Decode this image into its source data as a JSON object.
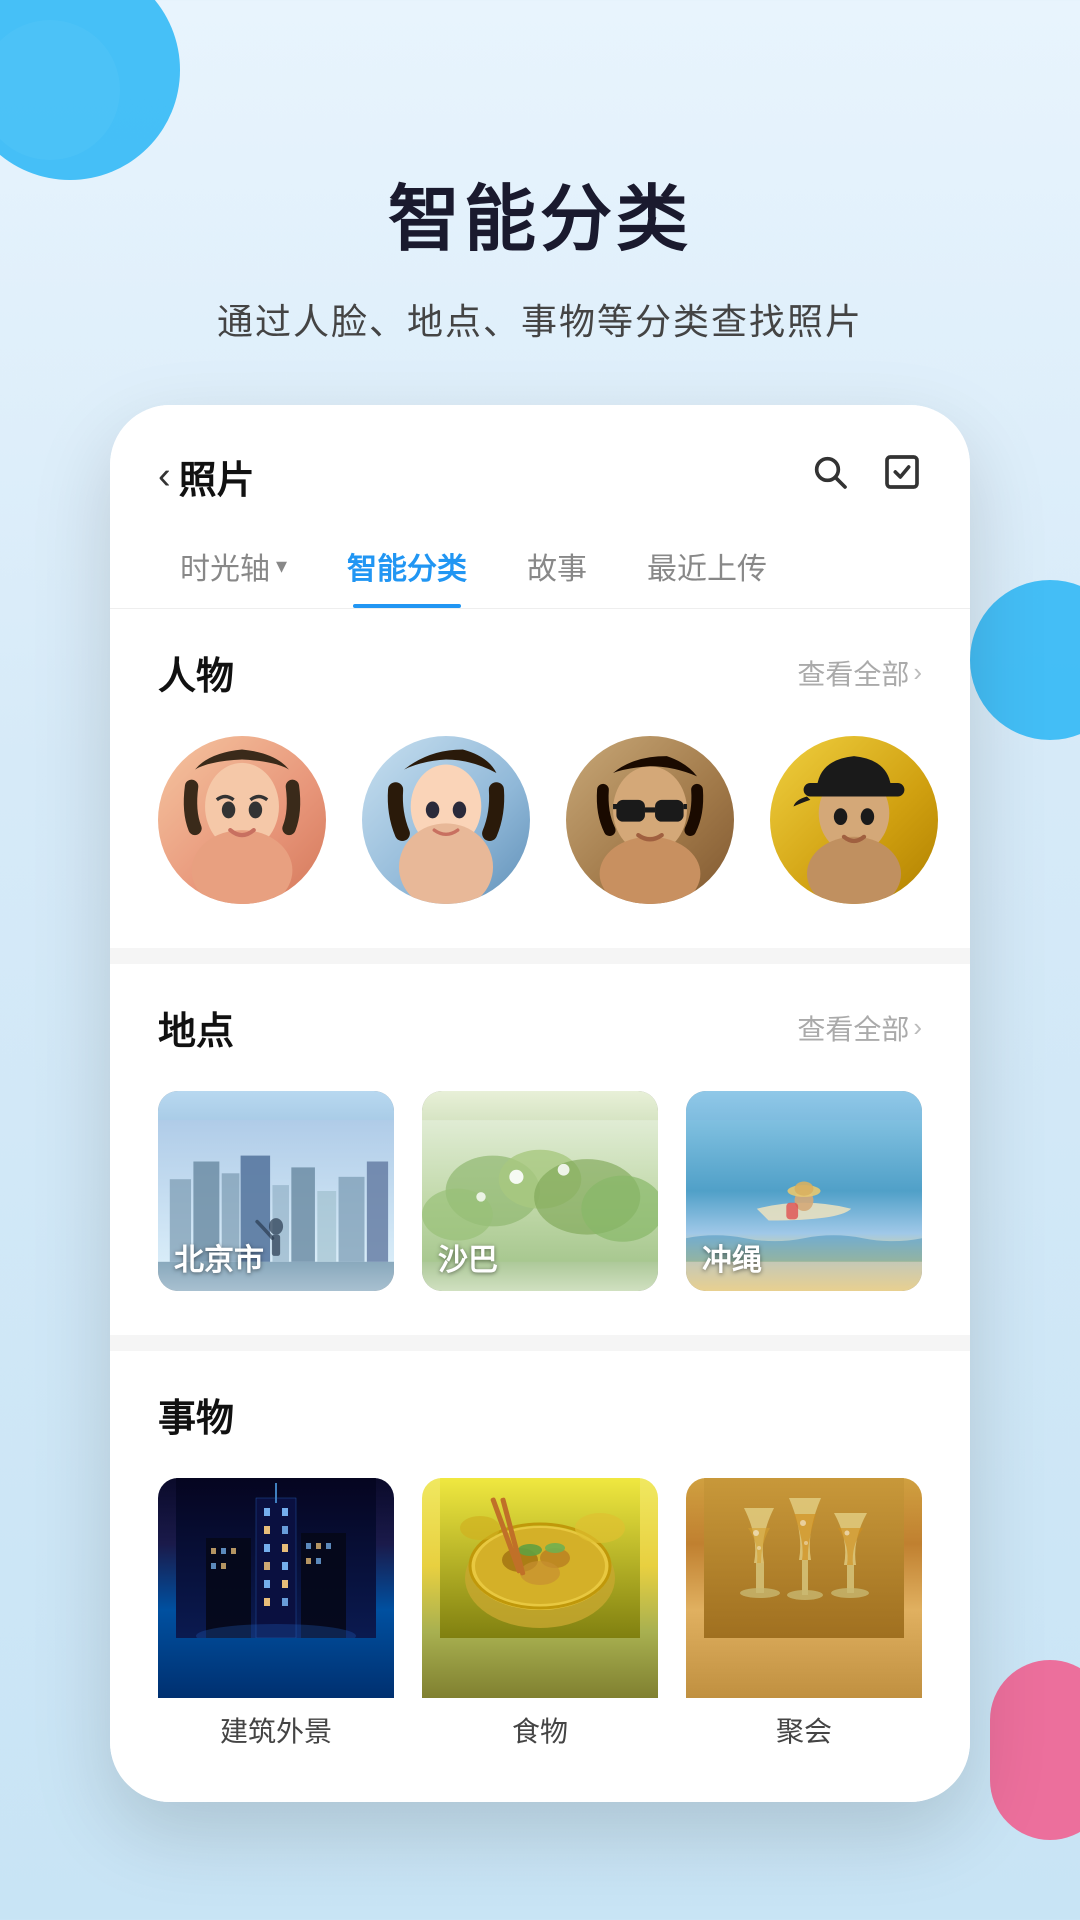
{
  "page": {
    "title": "智能分类",
    "subtitle": "通过人脸、地点、事物等分类查找照片"
  },
  "app": {
    "nav": {
      "back_label": "照片",
      "back_arrow": "‹",
      "search_icon": "🔍",
      "check_icon": "✓"
    },
    "tabs": [
      {
        "id": "timeline",
        "label": "时光轴",
        "has_arrow": true,
        "active": false
      },
      {
        "id": "smart",
        "label": "智能分类",
        "has_arrow": false,
        "active": true
      },
      {
        "id": "story",
        "label": "故事",
        "has_arrow": false,
        "active": false
      },
      {
        "id": "recent",
        "label": "最近上传",
        "has_arrow": false,
        "active": false
      }
    ],
    "sections": {
      "people": {
        "title": "人物",
        "more_label": "查看全部",
        "avatars": [
          {
            "id": "person1",
            "style": "avatar-1"
          },
          {
            "id": "person2",
            "style": "avatar-2"
          },
          {
            "id": "person3",
            "style": "avatar-3"
          },
          {
            "id": "person4",
            "style": "avatar-4"
          }
        ]
      },
      "location": {
        "title": "地点",
        "more_label": "查看全部",
        "cards": [
          {
            "id": "beijing",
            "label": "北京市",
            "style": "card-beijing"
          },
          {
            "id": "saba",
            "label": "沙巴",
            "style": "card-saba"
          },
          {
            "id": "okinawa",
            "label": "冲绳",
            "style": "card-okinawa"
          }
        ]
      },
      "things": {
        "title": "事物",
        "cards": [
          {
            "id": "building",
            "label": "建筑外景",
            "style": "card-building"
          },
          {
            "id": "food",
            "label": "食物",
            "style": "card-food"
          },
          {
            "id": "party",
            "label": "聚会",
            "style": "card-party"
          }
        ]
      }
    }
  },
  "colors": {
    "accent": "#2196f3",
    "background": "#e8f4fd",
    "text_primary": "#111",
    "text_secondary": "#888"
  }
}
